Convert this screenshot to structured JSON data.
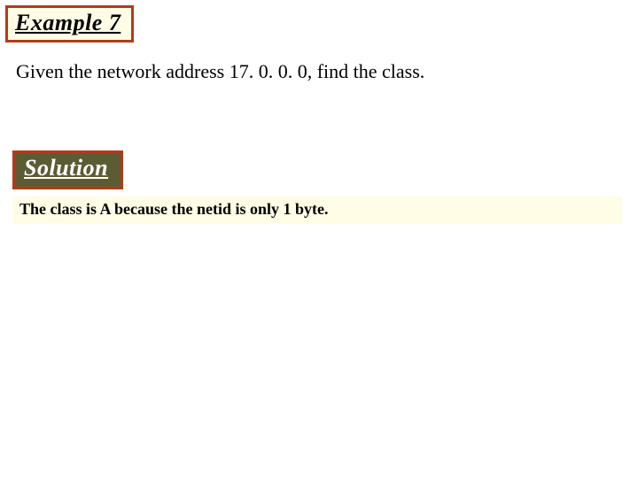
{
  "header": {
    "example_label": "Example 7"
  },
  "problem": {
    "text": "Given the network address 17. 0. 0. 0, find the class."
  },
  "solution": {
    "label": "Solution",
    "answer": "The class is A because the netid is only 1 byte."
  }
}
